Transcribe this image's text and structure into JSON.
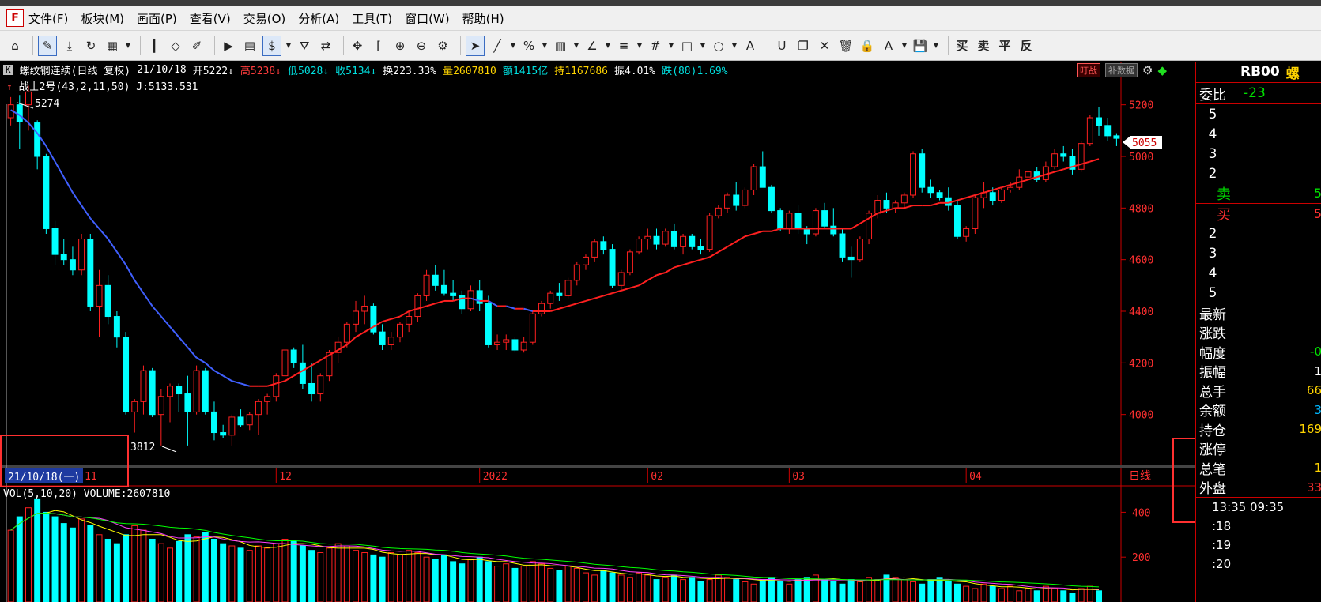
{
  "menu": [
    "文件(F)",
    "板块(M)",
    "画面(P)",
    "查看(V)",
    "交易(O)",
    "分析(A)",
    "工具(T)",
    "窗口(W)",
    "帮助(H)"
  ],
  "app_icon": "F",
  "toolbar_icons": [
    "home-icon",
    "draw-icon",
    "download-icon",
    "refresh-icon",
    "layout-icon",
    "candle-icon",
    "diamond-icon",
    "pencil-icon",
    "play-icon",
    "doc-icon",
    "dollar-icon",
    "filter-icon",
    "swap-icon",
    "move-icon",
    "bracket-icon",
    "zoom-in-icon",
    "zoom-out-icon",
    "settings-icon",
    "cursor-icon",
    "line-icon",
    "percent-icon",
    "bars-icon",
    "angle-icon",
    "levels-icon",
    "grid-icon",
    "rect-icon",
    "circle-icon",
    "text-icon",
    "magnet-icon",
    "copy-icon",
    "delete-icon",
    "trash-icon",
    "lock-icon",
    "font-icon",
    "save-icon"
  ],
  "toolbar_glyphs": [
    "⌂",
    "✎",
    "⤓",
    "↻",
    "▦",
    "┃",
    "◇",
    "✐",
    "▶",
    "▤",
    "$",
    "⛛",
    "⇄",
    "✥",
    "[",
    "⊕",
    "⊖",
    "⚙",
    "➤",
    "╱",
    "%",
    "▥",
    "∠",
    "≡",
    "#",
    "□",
    "○",
    "A",
    "U",
    "❐",
    "✕",
    "🗑",
    "🔒",
    "A",
    "💾"
  ],
  "toolbar_trade": [
    "买",
    "卖",
    "平",
    "反"
  ],
  "info": {
    "k_tag": "K",
    "title": "螺纹钢连续(日线 复权)",
    "date": "21/10/18",
    "open": "开5222↓",
    "high": "高5238↓",
    "low": "低5028↓",
    "close": "收5134↓",
    "turnover": "换223.33%",
    "volume": "量2607810",
    "amount": "额1415亿",
    "position": "持1167686",
    "amplitude": "振4.01%",
    "change": "跌(88)1.69%"
  },
  "indicator": {
    "arrow": "↑",
    "text": "战士2号(43,2,11,50) J:5133.531"
  },
  "right_buttons": {
    "b1": "叮战",
    "b2": "补数据"
  },
  "chart": {
    "high_label": "5274",
    "low_label": "3812",
    "price_tag": "5055",
    "cursor_date": "21/10/18(一)",
    "period_label": "日线",
    "y_ticks": [
      5200,
      5000,
      4800,
      4600,
      4400,
      4200,
      4000
    ],
    "x_labels": [
      {
        "label": "11",
        "i": 8
      },
      {
        "label": "12",
        "i": 30
      },
      {
        "label": "2022",
        "i": 53
      },
      {
        "label": "02",
        "i": 72
      },
      {
        "label": "03",
        "i": 88
      },
      {
        "label": "04",
        "i": 108
      }
    ],
    "vol_ticks": [
      400,
      200
    ],
    "vol_label": "VOL(5,10,20)  VOLUME:2607810",
    "colors": {
      "up": "#ff2020",
      "down": "#00ffff",
      "ma": "#ff2020",
      "ma_dn": "#4060ff"
    }
  },
  "chart_data": {
    "type": "candlestick",
    "ylim": [
      3800,
      5300
    ],
    "ohlc": [
      [
        5150,
        5230,
        5120,
        5200
      ],
      [
        5200,
        5238,
        5028,
        5134
      ],
      [
        5200,
        5274,
        5100,
        5250
      ],
      [
        5130,
        5140,
        4950,
        5000
      ],
      [
        5000,
        5010,
        4700,
        4720
      ],
      [
        4720,
        4750,
        4580,
        4620
      ],
      [
        4620,
        4680,
        4580,
        4600
      ],
      [
        4600,
        4650,
        4540,
        4560
      ],
      [
        4560,
        4700,
        4540,
        4680
      ],
      [
        4680,
        4700,
        4400,
        4420
      ],
      [
        4420,
        4560,
        4300,
        4500
      ],
      [
        4500,
        4540,
        4350,
        4380
      ],
      [
        4380,
        4400,
        4260,
        4300
      ],
      [
        4300,
        4320,
        4000,
        4010
      ],
      [
        4010,
        4060,
        3930,
        4050
      ],
      [
        4050,
        4190,
        4000,
        4170
      ],
      [
        4170,
        4180,
        3990,
        4000
      ],
      [
        4000,
        4100,
        3880,
        4070
      ],
      [
        4070,
        4120,
        3970,
        4110
      ],
      [
        4110,
        4120,
        4010,
        4080
      ],
      [
        4080,
        4150,
        3880,
        4010
      ],
      [
        4010,
        4190,
        4000,
        4170
      ],
      [
        4170,
        4180,
        4000,
        4010
      ],
      [
        4010,
        4050,
        3900,
        3930
      ],
      [
        3930,
        3960,
        3910,
        3920
      ],
      [
        3920,
        4000,
        3880,
        3990
      ],
      [
        3990,
        4020,
        3950,
        3960
      ],
      [
        3960,
        4010,
        3940,
        4000
      ],
      [
        4000,
        4060,
        3920,
        4050
      ],
      [
        4050,
        4080,
        4000,
        4070
      ],
      [
        4070,
        4160,
        4050,
        4150
      ],
      [
        4150,
        4260,
        4120,
        4250
      ],
      [
        4250,
        4260,
        4180,
        4200
      ],
      [
        4200,
        4270,
        4100,
        4120
      ],
      [
        4120,
        4200,
        4050,
        4080
      ],
      [
        4080,
        4160,
        4050,
        4150
      ],
      [
        4150,
        4250,
        4130,
        4240
      ],
      [
        4240,
        4300,
        4200,
        4280
      ],
      [
        4280,
        4360,
        4260,
        4350
      ],
      [
        4350,
        4440,
        4320,
        4400
      ],
      [
        4400,
        4460,
        4350,
        4420
      ],
      [
        4420,
        4430,
        4310,
        4320
      ],
      [
        4320,
        4350,
        4250,
        4270
      ],
      [
        4270,
        4320,
        4250,
        4300
      ],
      [
        4300,
        4360,
        4280,
        4350
      ],
      [
        4350,
        4400,
        4320,
        4380
      ],
      [
        4380,
        4470,
        4360,
        4460
      ],
      [
        4460,
        4560,
        4440,
        4540
      ],
      [
        4540,
        4580,
        4480,
        4500
      ],
      [
        4500,
        4560,
        4460,
        4470
      ],
      [
        4470,
        4520,
        4440,
        4460
      ],
      [
        4460,
        4480,
        4390,
        4410
      ],
      [
        4410,
        4500,
        4400,
        4480
      ],
      [
        4480,
        4520,
        4400,
        4430
      ],
      [
        4430,
        4460,
        4260,
        4270
      ],
      [
        4270,
        4310,
        4250,
        4280
      ],
      [
        4280,
        4310,
        4250,
        4290
      ],
      [
        4290,
        4300,
        4240,
        4250
      ],
      [
        4250,
        4300,
        4240,
        4280
      ],
      [
        4280,
        4400,
        4270,
        4390
      ],
      [
        4390,
        4440,
        4380,
        4430
      ],
      [
        4430,
        4480,
        4410,
        4470
      ],
      [
        4470,
        4510,
        4440,
        4460
      ],
      [
        4460,
        4530,
        4450,
        4520
      ],
      [
        4520,
        4590,
        4500,
        4580
      ],
      [
        4580,
        4620,
        4560,
        4610
      ],
      [
        4610,
        4680,
        4590,
        4670
      ],
      [
        4670,
        4690,
        4620,
        4640
      ],
      [
        4640,
        4660,
        4490,
        4500
      ],
      [
        4500,
        4560,
        4480,
        4550
      ],
      [
        4550,
        4640,
        4540,
        4630
      ],
      [
        4630,
        4690,
        4620,
        4680
      ],
      [
        4680,
        4720,
        4640,
        4690
      ],
      [
        4690,
        4720,
        4640,
        4660
      ],
      [
        4660,
        4720,
        4650,
        4710
      ],
      [
        4710,
        4740,
        4640,
        4650
      ],
      [
        4650,
        4700,
        4620,
        4690
      ],
      [
        4690,
        4700,
        4640,
        4650
      ],
      [
        4650,
        4680,
        4620,
        4640
      ],
      [
        4640,
        4780,
        4630,
        4770
      ],
      [
        4770,
        4810,
        4760,
        4800
      ],
      [
        4800,
        4860,
        4780,
        4850
      ],
      [
        4850,
        4900,
        4790,
        4810
      ],
      [
        4810,
        4880,
        4800,
        4870
      ],
      [
        4870,
        4970,
        4850,
        4960
      ],
      [
        4960,
        5020,
        4880,
        4880
      ],
      [
        4880,
        4890,
        4780,
        4790
      ],
      [
        4790,
        4800,
        4710,
        4720
      ],
      [
        4720,
        4790,
        4700,
        4780
      ],
      [
        4780,
        4810,
        4700,
        4720
      ],
      [
        4720,
        4730,
        4660,
        4700
      ],
      [
        4700,
        4800,
        4690,
        4790
      ],
      [
        4790,
        4820,
        4720,
        4730
      ],
      [
        4730,
        4800,
        4690,
        4700
      ],
      [
        4700,
        4720,
        4590,
        4610
      ],
      [
        4610,
        4650,
        4530,
        4600
      ],
      [
        4600,
        4690,
        4590,
        4680
      ],
      [
        4680,
        4790,
        4660,
        4780
      ],
      [
        4780,
        4850,
        4760,
        4830
      ],
      [
        4830,
        4860,
        4780,
        4800
      ],
      [
        4800,
        4830,
        4780,
        4820
      ],
      [
        4820,
        4860,
        4800,
        4850
      ],
      [
        4850,
        5020,
        4840,
        5010
      ],
      [
        5010,
        5030,
        4860,
        4880
      ],
      [
        4880,
        4910,
        4840,
        4860
      ],
      [
        4860,
        4870,
        4830,
        4840
      ],
      [
        4840,
        4880,
        4790,
        4810
      ],
      [
        4810,
        4830,
        4680,
        4690
      ],
      [
        4690,
        4730,
        4670,
        4720
      ],
      [
        4720,
        4850,
        4700,
        4840
      ],
      [
        4840,
        4900,
        4800,
        4860
      ],
      [
        4860,
        4880,
        4810,
        4830
      ],
      [
        4830,
        4880,
        4820,
        4870
      ],
      [
        4870,
        4900,
        4860,
        4880
      ],
      [
        4880,
        4950,
        4870,
        4920
      ],
      [
        4920,
        4960,
        4900,
        4940
      ],
      [
        4940,
        4960,
        4900,
        4910
      ],
      [
        4910,
        4980,
        4900,
        4960
      ],
      [
        4960,
        5030,
        4950,
        5010
      ],
      [
        5010,
        5040,
        4980,
        5000
      ],
      [
        5000,
        5030,
        4930,
        4950
      ],
      [
        4950,
        5060,
        4940,
        5050
      ],
      [
        5050,
        5160,
        5040,
        5150
      ],
      [
        5150,
        5190,
        5080,
        5120
      ],
      [
        5120,
        5150,
        5060,
        5080
      ],
      [
        5080,
        5090,
        5040,
        5070
      ]
    ],
    "ma": [
      5180,
      5160,
      5130,
      5090,
      5040,
      4980,
      4920,
      4860,
      4810,
      4760,
      4720,
      4680,
      4630,
      4580,
      4520,
      4470,
      4420,
      4380,
      4340,
      4300,
      4260,
      4220,
      4200,
      4170,
      4150,
      4130,
      4120,
      4110,
      4110,
      4110,
      4120,
      4130,
      4150,
      4170,
      4190,
      4210,
      4230,
      4250,
      4270,
      4300,
      4320,
      4340,
      4360,
      4370,
      4380,
      4400,
      4410,
      4420,
      4430,
      4440,
      4440,
      4450,
      4450,
      4440,
      4440,
      4420,
      4420,
      4410,
      4410,
      4400,
      4400,
      4400,
      4410,
      4420,
      4430,
      4440,
      4450,
      4460,
      4470,
      4480,
      4490,
      4500,
      4520,
      4540,
      4550,
      4570,
      4580,
      4590,
      4600,
      4610,
      4630,
      4650,
      4670,
      4690,
      4700,
      4710,
      4710,
      4720,
      4720,
      4720,
      4720,
      4720,
      4720,
      4720,
      4720,
      4720,
      4740,
      4760,
      4780,
      4790,
      4800,
      4800,
      4810,
      4810,
      4810,
      4820,
      4820,
      4830,
      4840,
      4850,
      4860,
      4870,
      4880,
      4890,
      4900,
      4910,
      4920,
      4930,
      4940,
      4950,
      4960,
      4970,
      4980,
      4990
    ],
    "volume": [
      320,
      380,
      420,
      460,
      400,
      380,
      350,
      330,
      370,
      340,
      300,
      280,
      260,
      300,
      340,
      320,
      280,
      260,
      240,
      270,
      300,
      290,
      310,
      280,
      260,
      250,
      240,
      230,
      250,
      240,
      260,
      280,
      270,
      250,
      230,
      220,
      240,
      260,
      250,
      230,
      220,
      210,
      200,
      220,
      210,
      230,
      220,
      200,
      190,
      210,
      180,
      170,
      190,
      200,
      180,
      160,
      170,
      150,
      160,
      180,
      170,
      150,
      140,
      160,
      150,
      130,
      120,
      140,
      130,
      120,
      110,
      130,
      120,
      100,
      110,
      120,
      100,
      110,
      90,
      100,
      120,
      110,
      100,
      90,
      80,
      100,
      110,
      90,
      80,
      100,
      110,
      120,
      100,
      90,
      80,
      100,
      90,
      110,
      100,
      120,
      110,
      100,
      90,
      80,
      100,
      110,
      90,
      80,
      70,
      60,
      80,
      70,
      60,
      70,
      50,
      60,
      50,
      70,
      60,
      50,
      40,
      60,
      70,
      50
    ]
  },
  "side": {
    "code": "RB00",
    "name_char": "螺",
    "weibi_label": "委比",
    "weibi_val": "-23",
    "asks": [
      "5",
      "4",
      "3",
      "2"
    ],
    "sell_label": "卖",
    "sell_val": "5",
    "buy_label": "买",
    "buy_val": "5",
    "bids": [
      "2",
      "3",
      "4",
      "5"
    ],
    "stats": [
      {
        "label": "最新",
        "val": "",
        "color": "#ffffff"
      },
      {
        "label": "涨跌",
        "val": "",
        "color": "#00e000"
      },
      {
        "label": "幅度",
        "val": "-0",
        "color": "#00e000"
      },
      {
        "label": "振幅",
        "val": "1",
        "color": "#ffffff"
      },
      {
        "label": "总手",
        "val": "66",
        "color": "#ffd400"
      },
      {
        "label": "余额",
        "val": "3",
        "color": "#00b8ff"
      },
      {
        "label": "持仓",
        "val": "169",
        "color": "#ffd400"
      },
      {
        "label": "涨停",
        "val": "",
        "color": "#ff3030"
      },
      {
        "label": "总笔",
        "val": "1",
        "color": "#ffd400"
      },
      {
        "label": "外盘",
        "val": "33",
        "color": "#ff3030"
      }
    ],
    "ticks": [
      "13:35 09:35",
      ":18",
      ":19",
      ":20"
    ]
  }
}
